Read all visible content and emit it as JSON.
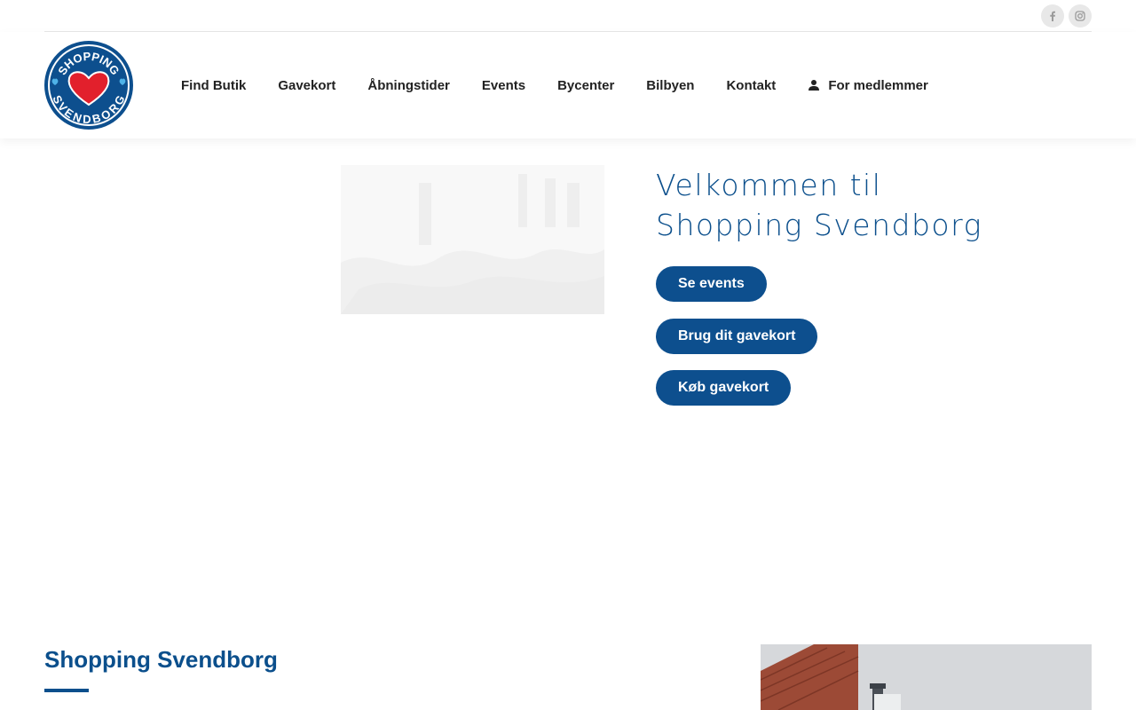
{
  "brand": {
    "logo_top": "SHOPPING",
    "logo_bottom": "SVENDBORG",
    "colors": {
      "primary": "#0d4f8e",
      "heart": "#e2202c",
      "title": "#0b4f8c"
    }
  },
  "social": [
    {
      "name": "facebook",
      "icon": "facebook-icon"
    },
    {
      "name": "instagram",
      "icon": "instagram-icon"
    }
  ],
  "nav": {
    "items": [
      {
        "label": "Find Butik"
      },
      {
        "label": "Gavekort"
      },
      {
        "label": "Åbningstider"
      },
      {
        "label": "Events"
      },
      {
        "label": "Bycenter"
      },
      {
        "label": "Bilbyen"
      },
      {
        "label": "Kontakt"
      }
    ],
    "members": {
      "label": "For medlemmer",
      "icon": "user-icon"
    }
  },
  "hero": {
    "title_line1": "Velkommen til",
    "title_line2": "Shopping Svendborg",
    "buttons": [
      {
        "label": "Se events"
      },
      {
        "label": "Brug dit gavekort"
      },
      {
        "label": "Køb gavekort"
      }
    ]
  },
  "section": {
    "title": "Shopping Svendborg"
  }
}
